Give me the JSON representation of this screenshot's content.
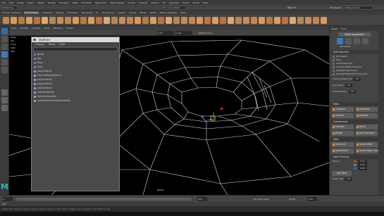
{
  "menubar": {
    "items": [
      "File",
      "Edit",
      "Create",
      "Select",
      "Modify",
      "Display",
      "Windows",
      "Mesh",
      "Edit Mesh",
      "Mesh Tools",
      "Mesh Display",
      "Curves",
      "Surfaces",
      "Deform",
      "UV",
      "Generate",
      "Cache",
      "Arnold",
      "Help"
    ]
  },
  "status": {
    "mode": "Modeling",
    "workspace_label": "Workspace:",
    "workspace": "Maya Classic",
    "sign_in": "Sign In",
    "live_surface": "No Live Surface"
  },
  "shelf_tabs": [
    "Curves / Surfaces",
    "Poly Modeling",
    "Sculpting",
    "Rigging",
    "Animation",
    "Rendering",
    "FX",
    "FX Caching",
    "Custom",
    "Arnold",
    "Bifrost",
    "MASH",
    "Motion Graphics",
    "XGen"
  ],
  "shelf_active": "Poly Modeling",
  "viewport": {
    "menu": [
      "View",
      "Shading",
      "Lighting",
      "Show",
      "Renderer",
      "Panels"
    ],
    "camera_label": "persp",
    "gamma": "sRGB gamma",
    "value_a": "0.00",
    "value_b": "1.00"
  },
  "left_list": [
    "Persp",
    "Top",
    "Front",
    "Side",
    "SPA..."
  ],
  "outliner": {
    "title": "Outliner",
    "menu": [
      "Display",
      "Show",
      "Help"
    ],
    "rows": [
      "persp",
      "top",
      "front",
      "side",
      "polySurface1",
      "GlenColPolySurface11",
      "polySurface2",
      "polySurface3",
      "polySurface4",
      "defaultLightSet",
      "defaultObjectSet",
      "modelPanel4ViewSelectedSet"
    ]
  },
  "right": {
    "tabs": [
      "Object",
      "Tools"
    ],
    "multi_component": "Multi-Component",
    "symmetry_label": "Symmetry:",
    "symmetry": "Off",
    "soft_selection": "Soft Selection",
    "options": [
      "Pick Matrix",
      "Drag",
      "Tweak/Marquee",
      "Camera Based Selection",
      "Highlight Backfaces",
      "Highlight Nearest Component"
    ],
    "fields": [
      {
        "label": "Camera Based Sel",
        "value": "Off"
      },
      {
        "label": "Symmetry",
        "value": "Off"
      },
      {
        "label": "Soft Selection",
        "value": "Off"
      }
    ],
    "sections": {
      "mesh": "Mesh",
      "components": "Components",
      "tools": "Tools",
      "mesh_settings": "Mesh Settings"
    },
    "mesh_buttons": [
      "Combine",
      "Separate",
      "Smooth",
      "Boolean"
    ],
    "component_buttons": [
      "Extrude",
      "Bevel",
      "Bridge",
      "Add Divisions"
    ],
    "tool_buttons": [
      "Multi-Cut",
      "Target Weld",
      "Quad Draw",
      "Insert Edge Loop"
    ],
    "settings": [
      {
        "label": "Object",
        "value": "0.10"
      },
      {
        "label": "",
        "value": "0.50"
      },
      {
        "label": "",
        "value": "0.88"
      }
    ],
    "add_new": "Add New",
    "step_snap_label": "Step Snap",
    "step_snap": "Off"
  },
  "timeline": {
    "start": "1",
    "end": "120",
    "current": "1.00",
    "anim_layer": "No Anim Layer",
    "fps": "24 fps"
  },
  "mel": "MEL",
  "help": "Select Tool: select an object. Drag to make a selection. Hold Shift to toggle, Ctrl to deselect, Ctrl+Shift to add.",
  "colors": {
    "accent": "#e08a28",
    "bg": "#444444",
    "mesh": "#d8d8d8"
  }
}
